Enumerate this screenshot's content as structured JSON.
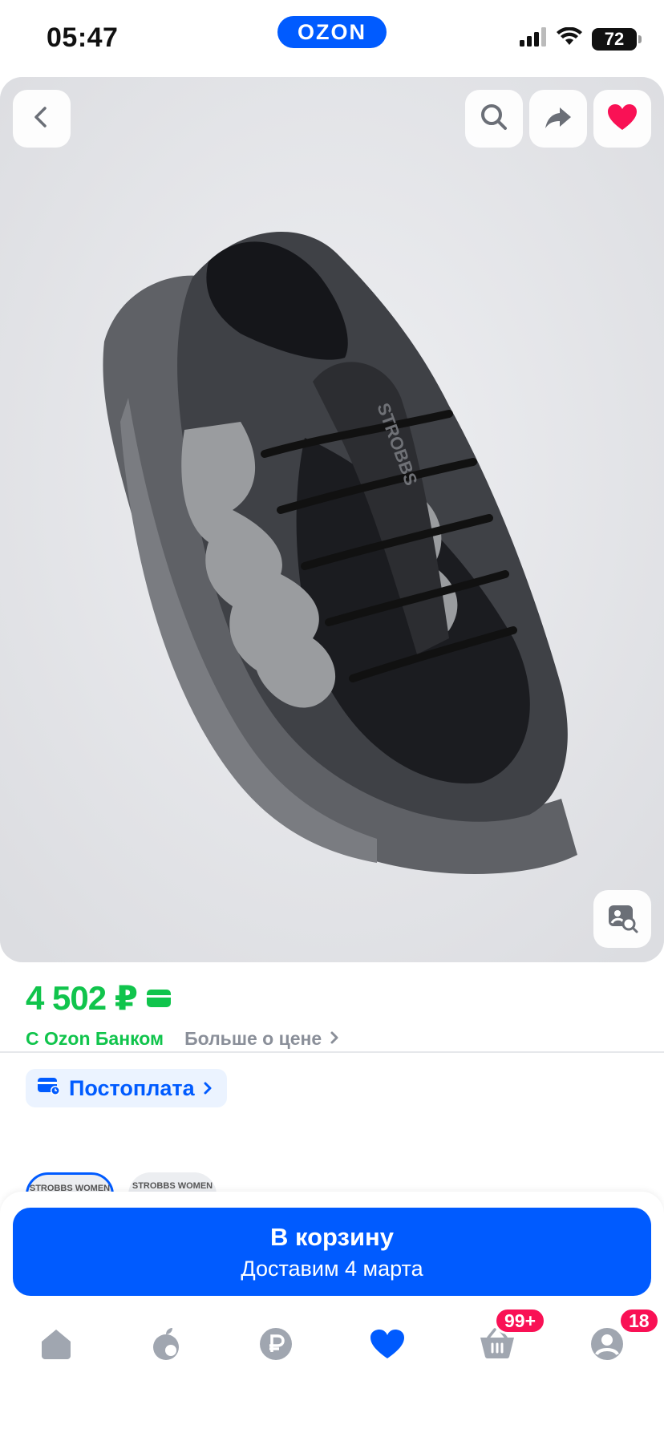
{
  "status_bar": {
    "time": "05:47",
    "battery": "72",
    "brand": "OZON"
  },
  "gallery": {
    "image_alt": "STROBBS sneaker",
    "shoe_logo_text": "STROBBS",
    "buttons": [
      "back-icon",
      "search-icon",
      "share-icon",
      "heart-icon",
      "visual-search-icon"
    ]
  },
  "price": {
    "amount": "4 502 ₽",
    "bank_label": "С Ozon Банком",
    "more_label": "Больше о цене",
    "postpay_label": "Постоплата",
    "accent_color": "#10c44c"
  },
  "variants": [
    {
      "label": "STROBBS WOMEN",
      "selected": true
    },
    {
      "label": "STROBBS WOMEN",
      "selected": false
    }
  ],
  "cart": {
    "title": "В корзину",
    "subtitle": "Доставим 4 марта",
    "color": "#005bff"
  },
  "nav": {
    "items": [
      {
        "name": "home-icon",
        "badge": ""
      },
      {
        "name": "fresh-icon",
        "badge": ""
      },
      {
        "name": "finance-icon",
        "badge": ""
      },
      {
        "name": "favorites-icon",
        "badge": ""
      },
      {
        "name": "cart-icon",
        "badge": "99+"
      },
      {
        "name": "profile-icon",
        "badge": "18"
      }
    ],
    "badge_color": "#f91155"
  }
}
